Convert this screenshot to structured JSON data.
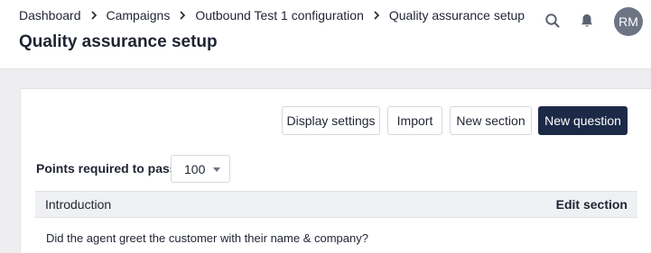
{
  "breadcrumb": {
    "items": [
      "Dashboard",
      "Campaigns",
      "Outbound Test 1 configuration",
      "Quality assurance setup"
    ]
  },
  "header": {
    "title": "Quality assurance setup",
    "icons": [
      "search-icon",
      "bell-icon"
    ],
    "avatar_initials": "RM"
  },
  "toolbar": {
    "display_settings_label": "Display settings",
    "import_label": "Import",
    "new_section_label": "New section",
    "new_question_label": "New question"
  },
  "points": {
    "label": "Points required to pass:",
    "value": "100"
  },
  "section": {
    "title": "Introduction",
    "edit_label": "Edit section",
    "questions": [
      "Did the agent greet the customer with their name & company?"
    ]
  },
  "colors": {
    "primary_button": "#1c2a48",
    "avatar": "#6d7585",
    "background": "#eeeef0"
  }
}
